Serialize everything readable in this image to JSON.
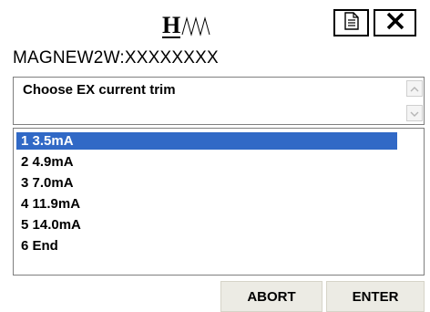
{
  "header": {
    "logo_icon": "hart-wave-logo",
    "document_icon": "document-icon",
    "close_icon": "close-icon"
  },
  "device": {
    "id": "MAGNEW2W:XXXXXXXX"
  },
  "prompt": {
    "text": "Choose EX current trim"
  },
  "options": [
    {
      "label": "1  3.5mA",
      "selected": true
    },
    {
      "label": "2  4.9mA",
      "selected": false
    },
    {
      "label": "3  7.0mA",
      "selected": false
    },
    {
      "label": "4 11.9mA",
      "selected": false
    },
    {
      "label": "5 14.0mA",
      "selected": false
    },
    {
      "label": "6 End",
      "selected": false
    }
  ],
  "buttons": {
    "abort": "ABORT",
    "enter": "ENTER"
  },
  "colors": {
    "selection": "#3169c6",
    "button_face": "#ecebe4"
  }
}
